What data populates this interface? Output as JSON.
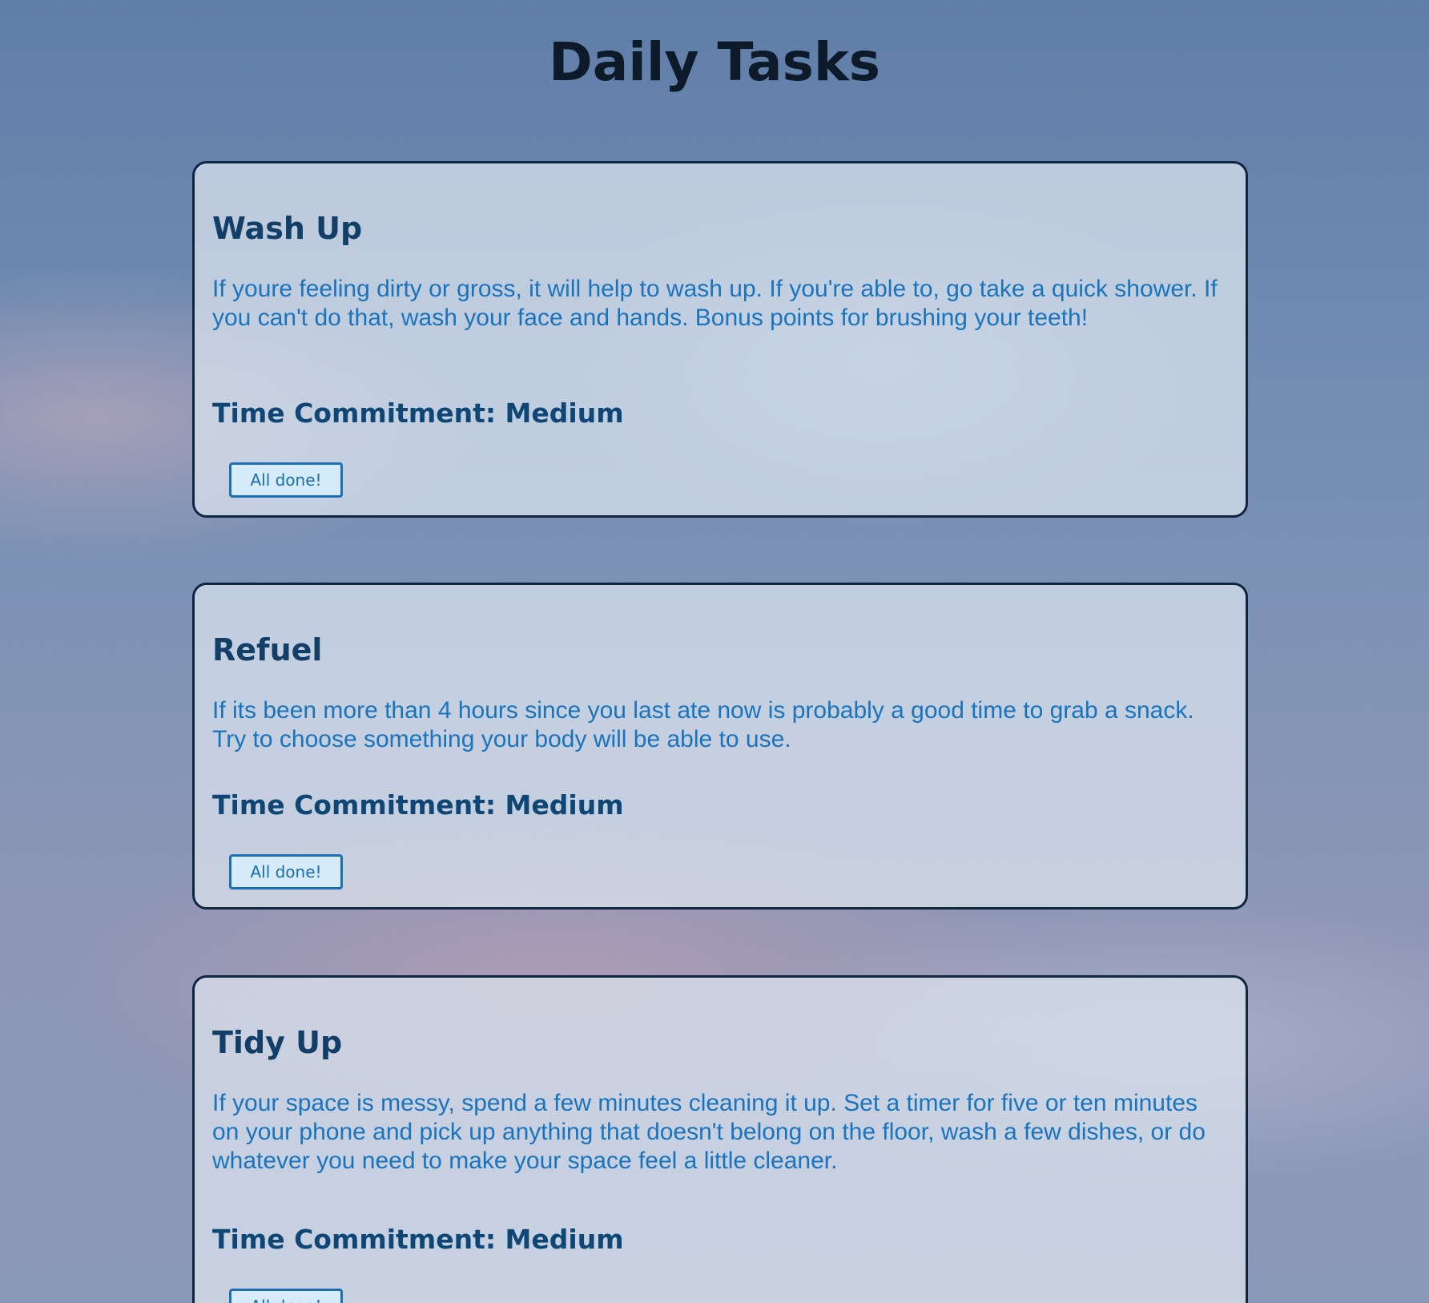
{
  "page": {
    "title": "Daily Tasks"
  },
  "tasks": [
    {
      "title": "Wash Up",
      "description": "If youre feeling dirty or gross, it will help to wash up. If you're able to, go take a quick shower. If you can't do that, wash your face and hands. Bonus points for brushing your teeth!",
      "time_commitment": "Time Commitment: Medium",
      "button_label": "All done!"
    },
    {
      "title": "Refuel",
      "description": "If its been more than 4 hours since you last ate now is probably a good time to grab a snack. Try to choose something your body will be able to use.",
      "time_commitment": "Time Commitment: Medium",
      "button_label": "All done!"
    },
    {
      "title": "Tidy Up",
      "description": "If your space is messy, spend a few minutes cleaning it up. Set a timer for five or ten minutes on your phone and pick up anything that doesn't belong on the floor, wash a few dishes, or do whatever you need to make your space feel a little cleaner.",
      "time_commitment": "Time Commitment: Medium",
      "button_label": "All done!"
    }
  ],
  "colors": {
    "card_border": "#0f2540",
    "title_text": "#133e68",
    "description_text": "#1a74bd",
    "button_border": "#1c6fb5"
  }
}
